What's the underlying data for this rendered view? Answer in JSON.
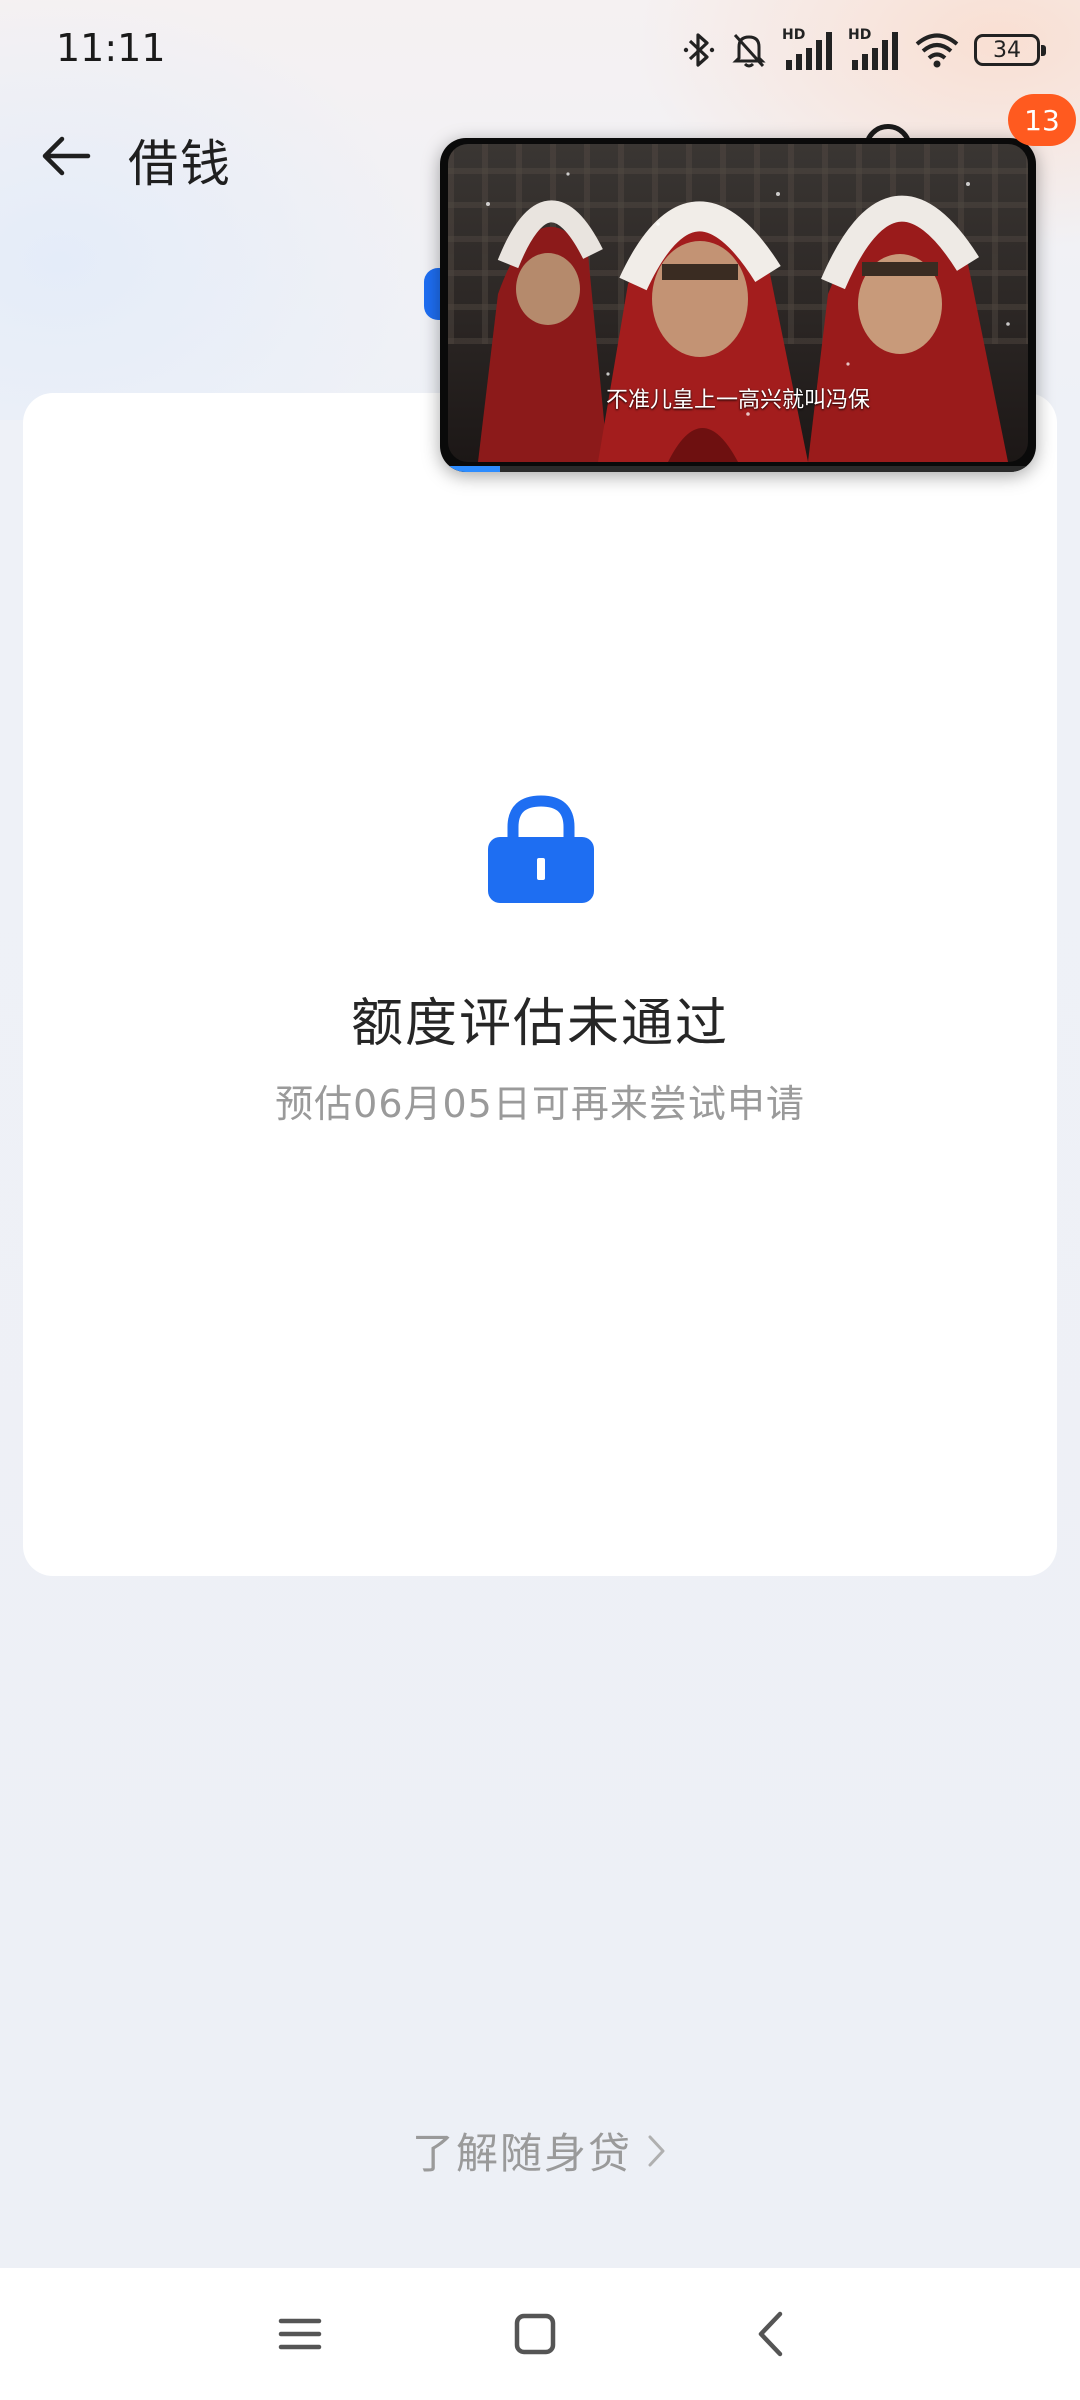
{
  "status_bar": {
    "time": "11:11",
    "battery": "34",
    "icons": [
      "bluetooth-icon",
      "mute-bell-icon",
      "hd-signal-icon",
      "hd-signal-icon",
      "wifi-icon",
      "battery-icon"
    ],
    "hd_label": "HD"
  },
  "header": {
    "title": "借钱",
    "back_icon": "arrow-left-icon"
  },
  "card": {
    "icon": "lock-icon",
    "title": "额度评估未通过",
    "subtitle": "预估06月05日可再来尝试申请",
    "accent_color": "#1e6ef2"
  },
  "footer": {
    "learn_more": "了解随身贷",
    "chevron_icon": "chevron-right-icon"
  },
  "pip_video": {
    "caption": "不准儿皇上一高兴就叫冯保",
    "progress": 0.1,
    "badge": "13",
    "badge_color": "#ff5a1f"
  },
  "nav_bar": {
    "icons": [
      "menu-icon",
      "home-icon",
      "back-icon"
    ]
  }
}
